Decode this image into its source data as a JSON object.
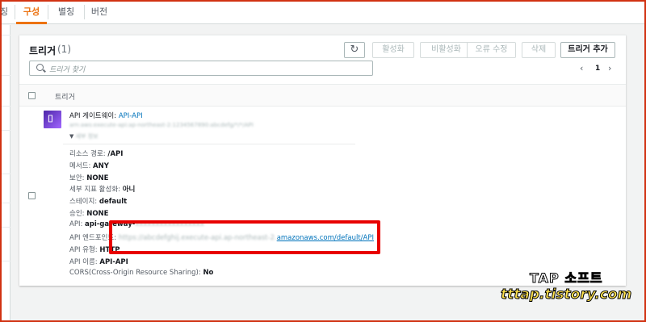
{
  "tabs": [
    {
      "label": "징"
    },
    {
      "label": "구성"
    },
    {
      "label": "별칭"
    },
    {
      "label": "버전"
    }
  ],
  "card": {
    "title": "트리거",
    "count": "(1)",
    "buttons": {
      "enable": "활성화",
      "disable": "비활성화",
      "fix_errors": "오류 수정",
      "delete": "삭제",
      "add_trigger": "트리거 추가"
    },
    "search_placeholder": "트리거 찾기",
    "page": "1",
    "column_header": "트리거"
  },
  "trigger": {
    "title_prefix": "API 게이트웨이:",
    "title_link": "API-API",
    "arn_blurred": "arn:aws:execute-api:ap-northeast-2:1234567890:abcdefg/*/*/API",
    "details_toggle": "세부 정보",
    "details": [
      {
        "key": "리소스 경로:",
        "value": "/API"
      },
      {
        "key": "메서드:",
        "value": "ANY"
      },
      {
        "key": "보안:",
        "value": "NONE"
      },
      {
        "key": "세부 지표 활성화:",
        "value": "아니"
      },
      {
        "key": "스테이지:",
        "value": "default"
      },
      {
        "key": "승인:",
        "value": "NONE"
      }
    ],
    "api_label": "API:",
    "api_value": "api-gateway-",
    "api_value_blurred": "xxxxxxxxxxxxxxxxx",
    "endpoint_label": "API 엔드포인트:",
    "endpoint_blurred": "https://abcdefghij.execute-api.ap-northeast-2.",
    "endpoint_visible": "amazonaws.com/default/API",
    "type_label": "API 유형:",
    "type_value": "HTTP",
    "name_label": "API 이름:",
    "name_value": "API-API",
    "cors_label": "CORS(Cross-Origin Resource Sharing):",
    "cors_value": "No"
  },
  "watermark": {
    "line1": "TAP 소프트",
    "line2": "tttap.tistory.com"
  },
  "colors": {
    "accent": "#ec7211",
    "link": "#0073bb",
    "highlight": "#e80000"
  }
}
